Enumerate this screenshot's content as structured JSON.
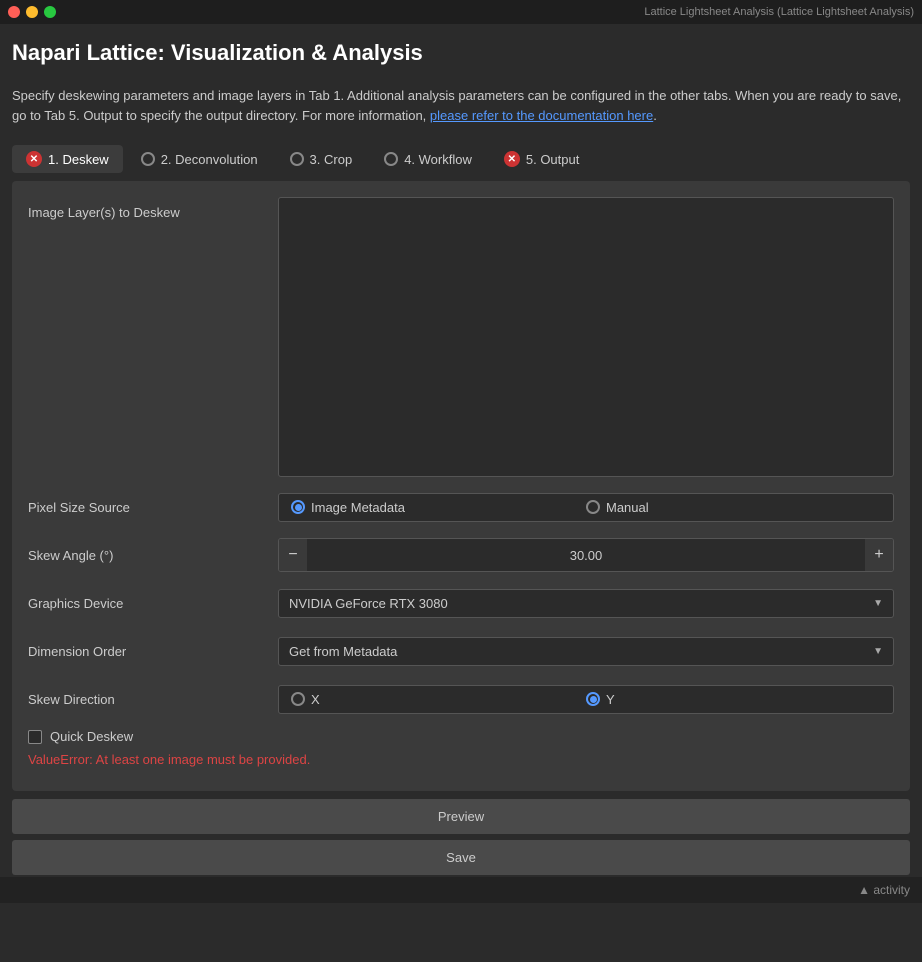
{
  "titleBar": {
    "title": "Lattice Lightsheet Analysis (Lattice Lightsheet Analysis)"
  },
  "app": {
    "title": "Napari Lattice: Visualization & Analysis",
    "description_part1": "Specify deskewing parameters and image layers in Tab 1.  Additional analysis parameters can be configured in the other tabs.  When you are ready to save, go to Tab 5. Output to specify the output directory.  For more information, ",
    "description_link": "please refer to the documentation here",
    "description_part2": "."
  },
  "tabs": [
    {
      "id": "deskew",
      "label": "1. Deskew",
      "icon": "error",
      "active": true
    },
    {
      "id": "deconvolution",
      "label": "2. Deconvolution",
      "icon": "radio",
      "active": false
    },
    {
      "id": "crop",
      "label": "3. Crop",
      "icon": "radio",
      "active": false
    },
    {
      "id": "workflow",
      "label": "4. Workflow",
      "icon": "radio",
      "active": false
    },
    {
      "id": "output",
      "label": "5. Output",
      "icon": "error",
      "active": false
    }
  ],
  "form": {
    "imageLayerLabel": "Image Layer(s) to Deskew",
    "pixelSizeSource": {
      "label": "Pixel Size Source",
      "options": [
        {
          "id": "image-metadata",
          "label": "Image Metadata",
          "selected": true
        },
        {
          "id": "manual",
          "label": "Manual",
          "selected": false
        }
      ]
    },
    "skewAngle": {
      "label": "Skew Angle (°)",
      "value": "30.00",
      "minusLabel": "−",
      "plusLabel": "+"
    },
    "graphicsDevice": {
      "label": "Graphics Device",
      "value": "NVIDIA GeForce RTX 3080"
    },
    "dimensionOrder": {
      "label": "Dimension Order",
      "value": "Get from Metadata"
    },
    "skewDirection": {
      "label": "Skew Direction",
      "options": [
        {
          "id": "x",
          "label": "X",
          "selected": false
        },
        {
          "id": "y",
          "label": "Y",
          "selected": true
        }
      ]
    },
    "quickDeskew": {
      "label": "Quick Deskew",
      "checked": false
    },
    "errorText": "ValueError: At least one image must be provided.",
    "previewLabel": "Preview",
    "saveLabel": "Save"
  },
  "bottomBar": {
    "activityLabel": "▲ activity"
  }
}
